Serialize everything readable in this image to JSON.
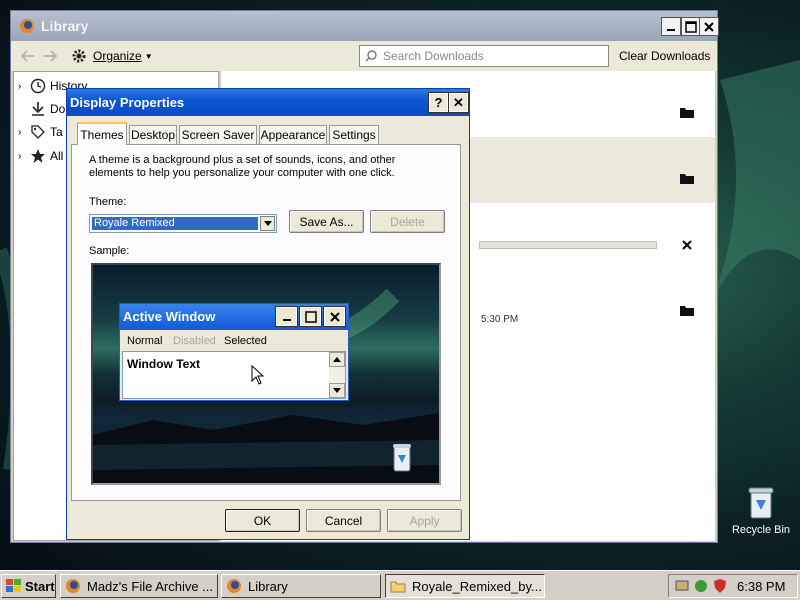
{
  "library": {
    "title": "Library",
    "organize_label": "Organize",
    "search_placeholder": "Search Downloads",
    "clear_label": "Clear Downloads",
    "sidebar": [
      {
        "label": "History",
        "icon": "clock-icon"
      },
      {
        "label": "Do",
        "icon": "download-icon"
      },
      {
        "label": "Ta",
        "icon": "tag-icon"
      },
      {
        "label": "All",
        "icon": "star-icon"
      }
    ],
    "download_time": "5:30 PM"
  },
  "dialog": {
    "title": "Display Properties",
    "help": "?",
    "close": "✕",
    "tabs": [
      "Themes",
      "Desktop",
      "Screen Saver",
      "Appearance",
      "Settings"
    ],
    "description": "A theme is a background plus a set of sounds, icons, and other elements to help you personalize your computer with one click.",
    "theme_label": "Theme:",
    "theme_value": "Royale Remixed",
    "save_as": "Save As...",
    "delete": "Delete",
    "sample_label": "Sample:",
    "ok": "OK",
    "cancel": "Cancel",
    "apply": "Apply",
    "active_window": {
      "title": "Active Window",
      "menu": [
        "Normal",
        "Disabled",
        "Selected"
      ],
      "text": "Window Text"
    }
  },
  "desktop": {
    "recycle_bin": "Recycle Bin"
  },
  "taskbar": {
    "start": "Start",
    "tasks": [
      "Madz's File Archive ...",
      "Library",
      "Royale_Remixed_by..."
    ],
    "clock": "6:38 PM"
  }
}
